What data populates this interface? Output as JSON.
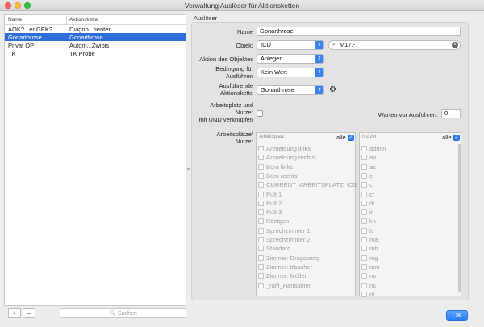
{
  "window": {
    "title": "Verwaltung Auslöser für Aktionsketten"
  },
  "left_list": {
    "columns": [
      "Name",
      "Aktionskette"
    ],
    "rows": [
      {
        "name": "AOK?...er GEK?",
        "chain": "Diagno...tienten",
        "selected": false
      },
      {
        "name": "Gonarthrose",
        "chain": "Gonarthrose",
        "selected": true
      },
      {
        "name": "Privat OP",
        "chain": "Autom...Zwibis",
        "selected": false
      },
      {
        "name": "TK",
        "chain": "TK Probe",
        "selected": false
      }
    ],
    "add_label": "+",
    "remove_label": "−",
    "search_placeholder": "Suchen"
  },
  "form": {
    "group_title": "Auslöser",
    "name_label": "Name",
    "name_value": "Gonarthrose",
    "objekt_label": "Objekt",
    "objekt_type": "ICD",
    "objekt_search_value": "M17.-",
    "aktion_label": "Aktion des Objektes",
    "aktion_value": "Anlegen",
    "bedingung_label_1": "Bedingung für",
    "bedingung_label_2": "Ausführen",
    "bedingung_value": "Kein Wert",
    "kette_label_1": "Ausführende",
    "kette_label_2": "Aktionskette",
    "kette_value": "Gonarthrose",
    "und_label_1": "Arbeitsplatz und",
    "und_label_2": "Nutzer",
    "und_label_3": "mit UND verknüpfen",
    "und_checked": false,
    "warten_label": "Warten vor Ausführen:",
    "warten_value": "0",
    "ap_label_1": "Arbeitsplätze/",
    "ap_label_2": "Nutzer"
  },
  "arbeitsplatz_list": {
    "header": "Arbeitsplatz",
    "alle_label": "alle",
    "alle_checked": true,
    "items": [
      "Anmeldung links",
      "Anmeldung rechts",
      "Büro links",
      "Büro rechts",
      "CURRENT_ARBEITSPLATZ_IOS",
      "Pult 1",
      "Pult 2",
      "Pult 3",
      "Röntgen",
      "Sprechzimmer 1",
      "Sprechzimmer 2",
      "Standard",
      "Zimmer: Dragowsky",
      "Zimmer: Irbacher",
      "Zimmer: Müller",
      "_raffi_Hanspeter"
    ]
  },
  "nutzer_list": {
    "header": "Nutzer",
    "alle_label": "alle",
    "alle_checked": true,
    "items": [
      "admin",
      "ap",
      "as",
      "cj",
      "cl",
      "cr",
      "dr",
      "ir",
      "kn",
      "ls",
      "ma",
      "mb",
      "mg",
      "mm",
      "mr",
      "ns",
      "nf"
    ]
  },
  "ok_label": "OK",
  "icons": {
    "dropdown": "chevron-updown-icon",
    "gear": "gear-icon",
    "search": "magnifier-icon",
    "clear": "clear-icon"
  },
  "colors": {
    "selection": "#2f6ed8",
    "accent": "#2f7ff0"
  }
}
